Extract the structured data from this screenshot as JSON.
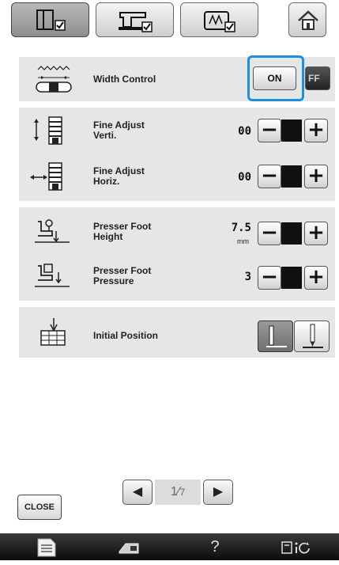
{
  "tabs": [
    {
      "name": "utility-settings-tab",
      "icon": "machine-settings-icon",
      "active": true
    },
    {
      "name": "sewing-settings-tab",
      "icon": "sewing-machine-icon",
      "active": false
    },
    {
      "name": "embroidery-settings-tab",
      "icon": "embroidery-frame-icon",
      "active": false
    }
  ],
  "home": {
    "icon": "home-icon"
  },
  "width_control": {
    "label": "Width Control",
    "on_label": "ON",
    "off_label": "FF",
    "state": "ON"
  },
  "fine_adjust_vert": {
    "label_1": "Fine Adjust",
    "label_2": "Verti.",
    "value": "00"
  },
  "fine_adjust_horiz": {
    "label_1": "Fine Adjust",
    "label_2": "Horiz.",
    "value": "00"
  },
  "presser_foot_height": {
    "label_1": "Presser Foot",
    "label_2": "Height",
    "value": "7.5",
    "unit": "mm"
  },
  "presser_foot_pressure": {
    "label_1": "Presser Foot",
    "label_2": "Pressure",
    "value": "3"
  },
  "initial_position": {
    "label": "Initial Position"
  },
  "controls": {
    "minus": "−",
    "plus": "+"
  },
  "pager": {
    "current": "1",
    "total": "7"
  },
  "close_label": "CLOSE",
  "bottom_bar": {
    "help": "?"
  },
  "colors": {
    "accent": "#1e8fe0",
    "panel": "#e6e6e6"
  }
}
